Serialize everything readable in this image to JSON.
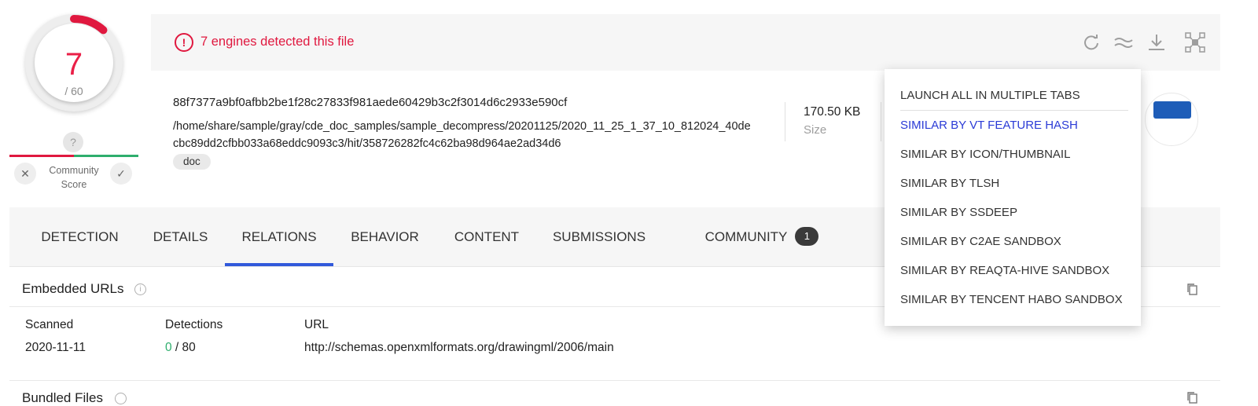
{
  "score": {
    "detections": "7",
    "total": "/ 60",
    "ratio": 0.1167
  },
  "community": {
    "unknown_icon": "?",
    "label_line1": "Community",
    "label_line2": "Score",
    "vote_down": "✕",
    "vote_up": "✓"
  },
  "header": {
    "alert_icon": "!",
    "alert_text": "7 engines detected this file",
    "tools": [
      "reanalyze-icon",
      "similar-icon",
      "download-icon",
      "graph-icon"
    ]
  },
  "file": {
    "hash": "88f7377a9bf0afbb2be1f28c27833f981aede60429b3c2f3014d6c2933e590cf",
    "path": "/home/share/sample/gray/cde_doc_samples/sample_decompress/20201125/2020_11_25_1_37_10_812024_40decbc89dd2cfbb033a68eddc9093c3/hit/358726282fc4c62ba98d964ae2ad34d6",
    "tag": "doc",
    "size_value": "170.50 KB",
    "size_label": "Size"
  },
  "tabs": {
    "detection": "DETECTION",
    "details": "DETAILS",
    "relations": "RELATIONS",
    "behavior": "BEHAVIOR",
    "content": "CONTENT",
    "submissions": "SUBMISSIONS",
    "community": "COMMUNITY",
    "community_badge": "1",
    "active": "RELATIONS"
  },
  "embedded_urls": {
    "title": "Embedded URLs",
    "columns": {
      "scanned": "Scanned",
      "detections": "Detections",
      "url": "URL"
    },
    "rows": [
      {
        "scanned": "2020-11-11",
        "detections_pos": "0",
        "detections_total": " / 80",
        "url": "http://schemas.openxmlformats.org/drawingml/2006/main"
      }
    ]
  },
  "bundled_files": {
    "title": "Bundled Files"
  },
  "dropdown": {
    "items": [
      "LAUNCH ALL IN MULTIPLE TABS",
      "SIMILAR BY VT FEATURE HASH",
      "SIMILAR BY ICON/THUMBNAIL",
      "SIMILAR BY TLSH",
      "SIMILAR BY SSDEEP",
      "SIMILAR BY C2AE SANDBOX",
      "SIMILAR BY REAQTA-HIVE SANDBOX",
      "SIMILAR BY TENCENT HABO SANDBOX"
    ],
    "highlighted": "SIMILAR BY VT FEATURE HASH"
  },
  "colors": {
    "alert": "#e0183f",
    "accent": "#3159db",
    "ok": "#2eae6d",
    "highlight": "#2b3bd6"
  }
}
